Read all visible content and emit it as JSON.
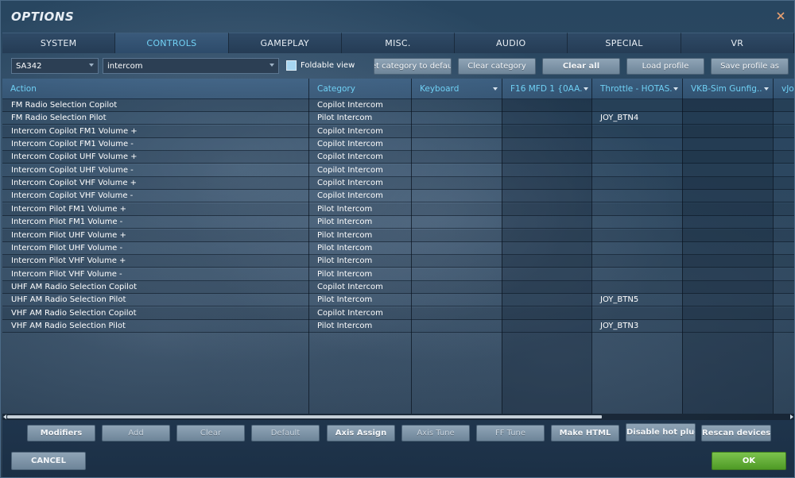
{
  "window": {
    "title": "OPTIONS",
    "close_icon": "close-icon"
  },
  "tabs": [
    {
      "label": "SYSTEM",
      "active": false
    },
    {
      "label": "CONTROLS",
      "active": true
    },
    {
      "label": "GAMEPLAY",
      "active": false
    },
    {
      "label": "MISC.",
      "active": false
    },
    {
      "label": "AUDIO",
      "active": false
    },
    {
      "label": "SPECIAL",
      "active": false
    },
    {
      "label": "VR",
      "active": false
    }
  ],
  "toolbar": {
    "aircraft_select": "SA342",
    "filter_value": "intercom",
    "foldable_view_label": "Foldable view",
    "foldable_view_checked": false,
    "reset_category_label": "Reset category to default",
    "clear_category_label": "Clear category",
    "clear_all_label": "Clear all",
    "load_profile_label": "Load profile",
    "save_profile_as_label": "Save profile as"
  },
  "table": {
    "headers": [
      {
        "label": "Action"
      },
      {
        "label": "Category"
      },
      {
        "label": "Keyboard"
      },
      {
        "label": "F16 MFD 1 {0AA..."
      },
      {
        "label": "Throttle - HOTAS..."
      },
      {
        "label": "VKB-Sim Gunfig..."
      },
      {
        "label": "vJoy"
      }
    ],
    "rows": [
      {
        "action": "FM Radio Selection Copilot",
        "category": "Copilot Intercom",
        "keyboard": "",
        "mfd": "",
        "throttle": "",
        "vkb": "",
        "vjoy": ""
      },
      {
        "action": "FM Radio Selection Pilot",
        "category": "Pilot Intercom",
        "keyboard": "",
        "mfd": "",
        "throttle": "JOY_BTN4",
        "vkb": "",
        "vjoy": ""
      },
      {
        "action": "Intercom Copilot FM1 Volume +",
        "category": "Copilot Intercom",
        "keyboard": "",
        "mfd": "",
        "throttle": "",
        "vkb": "",
        "vjoy": ""
      },
      {
        "action": "Intercom Copilot FM1 Volume -",
        "category": "Copilot Intercom",
        "keyboard": "",
        "mfd": "",
        "throttle": "",
        "vkb": "",
        "vjoy": ""
      },
      {
        "action": "Intercom Copilot UHF Volume +",
        "category": "Copilot Intercom",
        "keyboard": "",
        "mfd": "",
        "throttle": "",
        "vkb": "",
        "vjoy": ""
      },
      {
        "action": "Intercom Copilot UHF Volume -",
        "category": "Copilot Intercom",
        "keyboard": "",
        "mfd": "",
        "throttle": "",
        "vkb": "",
        "vjoy": ""
      },
      {
        "action": "Intercom Copilot VHF Volume +",
        "category": "Copilot Intercom",
        "keyboard": "",
        "mfd": "",
        "throttle": "",
        "vkb": "",
        "vjoy": ""
      },
      {
        "action": "Intercom Copilot VHF Volume -",
        "category": "Copilot Intercom",
        "keyboard": "",
        "mfd": "",
        "throttle": "",
        "vkb": "",
        "vjoy": ""
      },
      {
        "action": "Intercom Pilot FM1 Volume +",
        "category": "Pilot Intercom",
        "keyboard": "",
        "mfd": "",
        "throttle": "",
        "vkb": "",
        "vjoy": ""
      },
      {
        "action": "Intercom Pilot FM1 Volume -",
        "category": "Pilot Intercom",
        "keyboard": "",
        "mfd": "",
        "throttle": "",
        "vkb": "",
        "vjoy": ""
      },
      {
        "action": "Intercom Pilot UHF Volume +",
        "category": "Pilot Intercom",
        "keyboard": "",
        "mfd": "",
        "throttle": "",
        "vkb": "",
        "vjoy": ""
      },
      {
        "action": "Intercom Pilot UHF Volume -",
        "category": "Pilot Intercom",
        "keyboard": "",
        "mfd": "",
        "throttle": "",
        "vkb": "",
        "vjoy": ""
      },
      {
        "action": "Intercom Pilot VHF Volume +",
        "category": "Pilot Intercom",
        "keyboard": "",
        "mfd": "",
        "throttle": "",
        "vkb": "",
        "vjoy": ""
      },
      {
        "action": "Intercom Pilot VHF Volume -",
        "category": "Pilot Intercom",
        "keyboard": "",
        "mfd": "",
        "throttle": "",
        "vkb": "",
        "vjoy": ""
      },
      {
        "action": "UHF AM Radio Selection Copilot",
        "category": "Copilot Intercom",
        "keyboard": "",
        "mfd": "",
        "throttle": "",
        "vkb": "",
        "vjoy": ""
      },
      {
        "action": "UHF AM Radio Selection Pilot",
        "category": "Pilot Intercom",
        "keyboard": "",
        "mfd": "",
        "throttle": "JOY_BTN5",
        "vkb": "",
        "vjoy": ""
      },
      {
        "action": "VHF AM Radio Selection Copilot",
        "category": "Copilot Intercom",
        "keyboard": "",
        "mfd": "",
        "throttle": "",
        "vkb": "",
        "vjoy": ""
      },
      {
        "action": "VHF AM Radio Selection Pilot",
        "category": "Pilot Intercom",
        "keyboard": "",
        "mfd": "",
        "throttle": "JOY_BTN3",
        "vkb": "",
        "vjoy": ""
      }
    ]
  },
  "bottom_buttons": [
    {
      "label": "Modifiers",
      "enabled": true
    },
    {
      "label": "Add",
      "enabled": false
    },
    {
      "label": "Clear",
      "enabled": false
    },
    {
      "label": "Default",
      "enabled": false
    },
    {
      "label": "Axis Assign",
      "enabled": true
    },
    {
      "label": "Axis Tune",
      "enabled": false
    },
    {
      "label": "FF Tune",
      "enabled": false
    },
    {
      "label": "Make HTML",
      "enabled": true
    },
    {
      "label": "Disable hot plug",
      "enabled": true
    },
    {
      "label": "Rescan devices",
      "enabled": true
    }
  ],
  "footer": {
    "cancel_label": "CANCEL",
    "ok_label": "OK"
  },
  "colors": {
    "accent_text": "#6fd0f4",
    "ok_green": "#5aa82d",
    "button_grey": "#7d93a7"
  }
}
